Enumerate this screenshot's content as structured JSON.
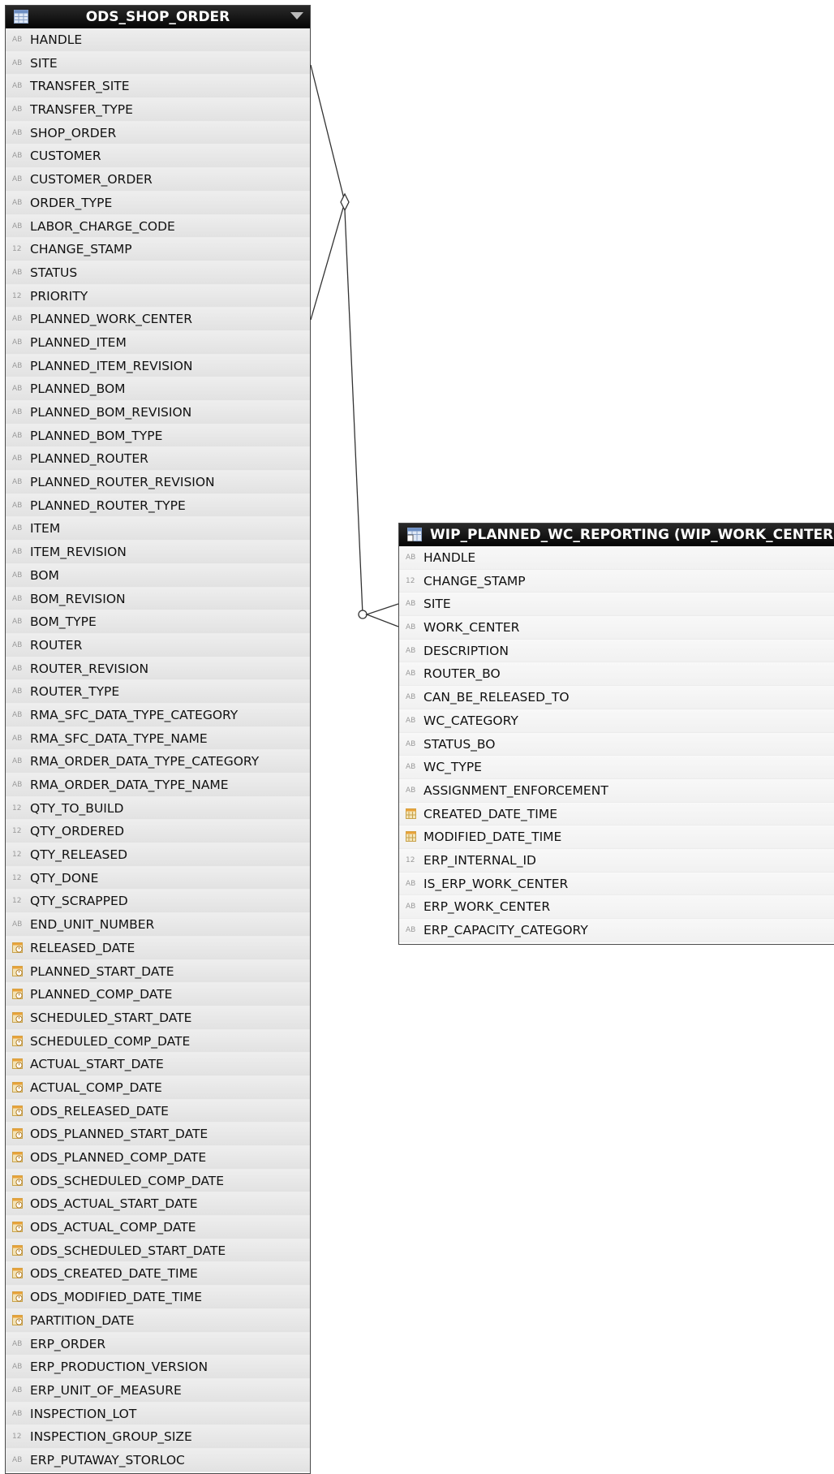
{
  "left_table": {
    "title": "ODS_SHOP_ORDER",
    "columns": [
      {
        "name": "HANDLE",
        "type": "text"
      },
      {
        "name": "SITE",
        "type": "text"
      },
      {
        "name": "TRANSFER_SITE",
        "type": "text"
      },
      {
        "name": "TRANSFER_TYPE",
        "type": "text"
      },
      {
        "name": "SHOP_ORDER",
        "type": "text"
      },
      {
        "name": "CUSTOMER",
        "type": "text"
      },
      {
        "name": "CUSTOMER_ORDER",
        "type": "text"
      },
      {
        "name": "ORDER_TYPE",
        "type": "text"
      },
      {
        "name": "LABOR_CHARGE_CODE",
        "type": "text"
      },
      {
        "name": "CHANGE_STAMP",
        "type": "number"
      },
      {
        "name": "STATUS",
        "type": "text"
      },
      {
        "name": "PRIORITY",
        "type": "number"
      },
      {
        "name": "PLANNED_WORK_CENTER",
        "type": "text"
      },
      {
        "name": "PLANNED_ITEM",
        "type": "text"
      },
      {
        "name": "PLANNED_ITEM_REVISION",
        "type": "text"
      },
      {
        "name": "PLANNED_BOM",
        "type": "text"
      },
      {
        "name": "PLANNED_BOM_REVISION",
        "type": "text"
      },
      {
        "name": "PLANNED_BOM_TYPE",
        "type": "text"
      },
      {
        "name": "PLANNED_ROUTER",
        "type": "text"
      },
      {
        "name": "PLANNED_ROUTER_REVISION",
        "type": "text"
      },
      {
        "name": "PLANNED_ROUTER_TYPE",
        "type": "text"
      },
      {
        "name": "ITEM",
        "type": "text"
      },
      {
        "name": "ITEM_REVISION",
        "type": "text"
      },
      {
        "name": "BOM",
        "type": "text"
      },
      {
        "name": "BOM_REVISION",
        "type": "text"
      },
      {
        "name": "BOM_TYPE",
        "type": "text"
      },
      {
        "name": "ROUTER",
        "type": "text"
      },
      {
        "name": "ROUTER_REVISION",
        "type": "text"
      },
      {
        "name": "ROUTER_TYPE",
        "type": "text"
      },
      {
        "name": "RMA_SFC_DATA_TYPE_CATEGORY",
        "type": "text"
      },
      {
        "name": "RMA_SFC_DATA_TYPE_NAME",
        "type": "text"
      },
      {
        "name": "RMA_ORDER_DATA_TYPE_CATEGORY",
        "type": "text"
      },
      {
        "name": "RMA_ORDER_DATA_TYPE_NAME",
        "type": "text"
      },
      {
        "name": "QTY_TO_BUILD",
        "type": "number"
      },
      {
        "name": "QTY_ORDERED",
        "type": "number"
      },
      {
        "name": "QTY_RELEASED",
        "type": "number"
      },
      {
        "name": "QTY_DONE",
        "type": "number"
      },
      {
        "name": "QTY_SCRAPPED",
        "type": "number"
      },
      {
        "name": "END_UNIT_NUMBER",
        "type": "text"
      },
      {
        "name": "RELEASED_DATE",
        "type": "datetime"
      },
      {
        "name": "PLANNED_START_DATE",
        "type": "datetime"
      },
      {
        "name": "PLANNED_COMP_DATE",
        "type": "datetime"
      },
      {
        "name": "SCHEDULED_START_DATE",
        "type": "datetime"
      },
      {
        "name": "SCHEDULED_COMP_DATE",
        "type": "datetime"
      },
      {
        "name": "ACTUAL_START_DATE",
        "type": "datetime"
      },
      {
        "name": "ACTUAL_COMP_DATE",
        "type": "datetime"
      },
      {
        "name": "ODS_RELEASED_DATE",
        "type": "datetime"
      },
      {
        "name": "ODS_PLANNED_START_DATE",
        "type": "datetime"
      },
      {
        "name": "ODS_PLANNED_COMP_DATE",
        "type": "datetime"
      },
      {
        "name": "ODS_SCHEDULED_COMP_DATE",
        "type": "datetime"
      },
      {
        "name": "ODS_ACTUAL_START_DATE",
        "type": "datetime"
      },
      {
        "name": "ODS_ACTUAL_COMP_DATE",
        "type": "datetime"
      },
      {
        "name": "ODS_SCHEDULED_START_DATE",
        "type": "datetime"
      },
      {
        "name": "ODS_CREATED_DATE_TIME",
        "type": "datetime"
      },
      {
        "name": "ODS_MODIFIED_DATE_TIME",
        "type": "datetime"
      },
      {
        "name": "PARTITION_DATE",
        "type": "datetime"
      },
      {
        "name": "ERP_ORDER",
        "type": "text"
      },
      {
        "name": "ERP_PRODUCTION_VERSION",
        "type": "text"
      },
      {
        "name": "ERP_UNIT_OF_MEASURE",
        "type": "text"
      },
      {
        "name": "INSPECTION_LOT",
        "type": "text"
      },
      {
        "name": "INSPECTION_GROUP_SIZE",
        "type": "number"
      },
      {
        "name": "ERP_PUTAWAY_STORLOC",
        "type": "text"
      }
    ]
  },
  "right_table": {
    "title": "WIP_PLANNED_WC_REPORTING (WIP_WORK_CENTER)",
    "columns": [
      {
        "name": "HANDLE",
        "type": "text"
      },
      {
        "name": "CHANGE_STAMP",
        "type": "number"
      },
      {
        "name": "SITE",
        "type": "text"
      },
      {
        "name": "WORK_CENTER",
        "type": "text"
      },
      {
        "name": "DESCRIPTION",
        "type": "text"
      },
      {
        "name": "ROUTER_BO",
        "type": "text"
      },
      {
        "name": "CAN_BE_RELEASED_TO",
        "type": "text"
      },
      {
        "name": "WC_CATEGORY",
        "type": "text"
      },
      {
        "name": "STATUS_BO",
        "type": "text"
      },
      {
        "name": "WC_TYPE",
        "type": "text"
      },
      {
        "name": "ASSIGNMENT_ENFORCEMENT",
        "type": "text"
      },
      {
        "name": "CREATED_DATE_TIME",
        "type": "date"
      },
      {
        "name": "MODIFIED_DATE_TIME",
        "type": "date"
      },
      {
        "name": "ERP_INTERNAL_ID",
        "type": "number"
      },
      {
        "name": "IS_ERP_WORK_CENTER",
        "type": "text"
      },
      {
        "name": "ERP_WORK_CENTER",
        "type": "text"
      },
      {
        "name": "ERP_CAPACITY_CATEGORY",
        "type": "text"
      }
    ]
  },
  "type_glyphs": {
    "text": "AB",
    "number": "12"
  },
  "colors": {
    "header": "#0a0a0a",
    "row": "#e8e8e8",
    "line": "#333333"
  }
}
